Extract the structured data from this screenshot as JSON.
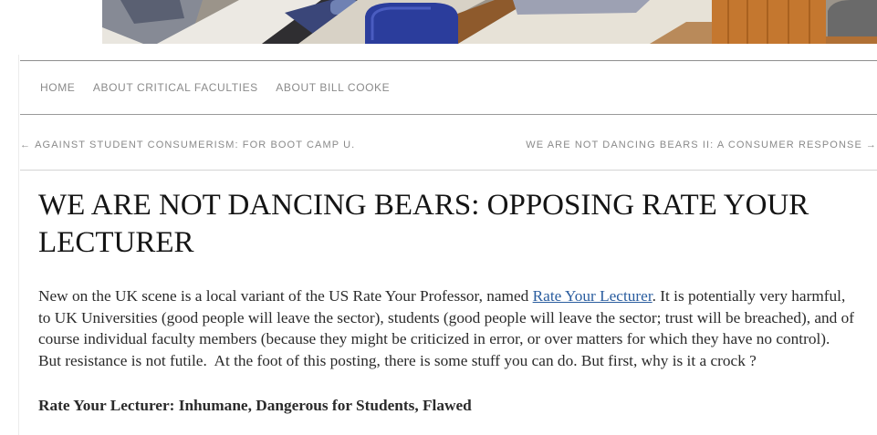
{
  "header": {
    "image_icon": "lecture-hall-photo"
  },
  "nav": {
    "items": [
      {
        "label": "HOME"
      },
      {
        "label": "ABOUT CRITICAL FACULTIES"
      },
      {
        "label": "ABOUT BILL COOKE"
      }
    ]
  },
  "post_nav": {
    "prev_arrow": "←",
    "prev_label": "AGAINST STUDENT CONSUMERISM: FOR BOOT CAMP U.",
    "next_label": "WE ARE NOT DANCING BEARS II: A CONSUMER RESPONSE",
    "next_arrow": "→"
  },
  "post": {
    "title": "WE ARE NOT DANCING BEARS: OPPOSING RATE YOUR LECTURER",
    "intro": {
      "line1_before_link": "New on the UK scene is a local variant of the US Rate Your Professor, named ",
      "link_text": "Rate Your Lecturer",
      "line1_after_link": ". It is potentially very harmful,",
      "line2": "to UK Universities (good people will leave the sector), students (good people will leave the sector; trust will be breached), and of",
      "line3": "course individual faculty members (because they might be criticized in error, or over matters for which they have no control).",
      "line4": "But resistance is not futile.  At the foot of this posting, there is some stuff you can do. But first, why is it a crock ?"
    },
    "subheading": "Rate Your Lecturer: Inhumane, Dangerous for Students, Flawed"
  },
  "colors": {
    "text": "#2b2b2b",
    "title": "#141414",
    "nav_text": "#8a8a8a",
    "link": "#2a5d9f",
    "rule": "#8e8e8e"
  }
}
